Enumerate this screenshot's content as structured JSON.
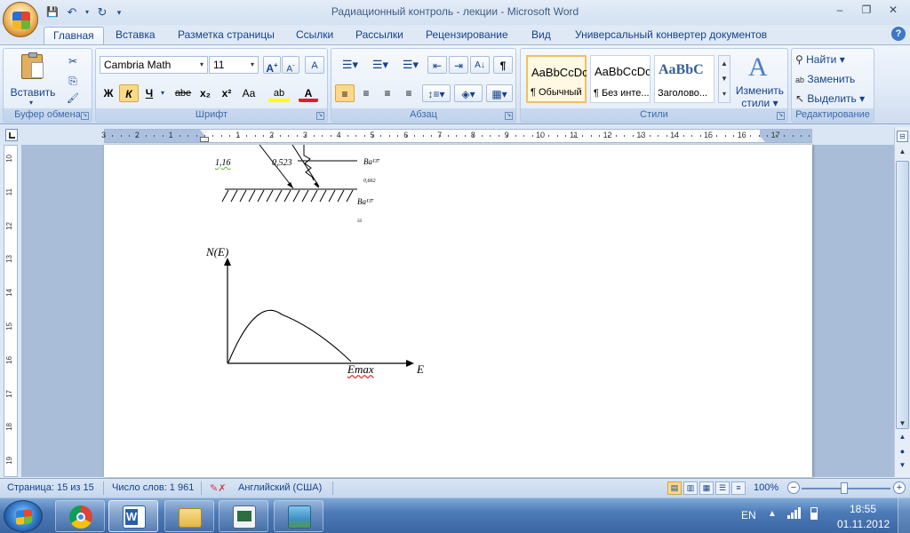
{
  "window": {
    "title": "Радиационный контроль - лекции - Microsoft Word",
    "controls": {
      "minimize": "–",
      "restore": "❐",
      "close": "✕"
    }
  },
  "quick_access": {
    "save": "💾",
    "undo": "↶",
    "redo": "↻",
    "customize": "▾"
  },
  "tabs": [
    "Главная",
    "Вставка",
    "Разметка страницы",
    "Ссылки",
    "Рассылки",
    "Рецензирование",
    "Вид",
    "Универсальный конвертер документов"
  ],
  "help": "?",
  "ribbon": {
    "clipboard": {
      "label": "Буфер обмена",
      "paste": "Вставить",
      "cut": "✂",
      "copy": "⎘",
      "painter": "🖌"
    },
    "font": {
      "label": "Шрифт",
      "family": "Cambria Math",
      "size": "11",
      "grow": "A",
      "grow_sup": "+",
      "shrink": "A",
      "shrink_sup": "-",
      "clear": "A",
      "bold": "Ж",
      "italic": "К",
      "underline": "Ч",
      "strike": "abe",
      "sub": "x₂",
      "sup": "x²",
      "case": "Aa",
      "highlight": "ab",
      "color": "A"
    },
    "paragraph": {
      "label": "Абзац",
      "pilcrow": "¶",
      "sort": "A↓"
    },
    "styles": {
      "label": "Стили",
      "items": [
        {
          "preview": "AaBbCcDc",
          "name": "¶ Обычный"
        },
        {
          "preview": "AaBbCcDc",
          "name": "¶ Без инте..."
        },
        {
          "preview": "AaBbC",
          "name": "Заголово..."
        }
      ],
      "change_label_1": "Изменить",
      "change_label_2": "стили ▾",
      "change_icon": "A"
    },
    "editing": {
      "label": "Редактирование",
      "find": "Найти ▾",
      "replace": "Заменить",
      "select": "Выделить ▾"
    }
  },
  "ruler": {
    "horizontal_ticks": [
      "3",
      "2",
      "1",
      "1",
      "2",
      "3",
      "4",
      "5",
      "6",
      "7",
      "8",
      "9",
      "10",
      "11",
      "12",
      "13",
      "14",
      "15",
      "16",
      "17"
    ],
    "vertical_ticks": [
      "10",
      "11",
      "12",
      "13",
      "14",
      "15",
      "16",
      "17",
      "18",
      "19"
    ]
  },
  "document": {
    "top_figure": {
      "energy_1": "1,16",
      "energy_2": "0,523",
      "level_upper": "Ba¹³⁷",
      "level_middle": "0,662",
      "level_ground": "Ba¹³⁷",
      "mass_number": "56"
    },
    "spectrum_graph": {
      "y_label": "N(E)",
      "x_label": "E",
      "emax_label": "Emax"
    }
  },
  "status_bar": {
    "page": "Страница: 15 из 15",
    "words": "Число слов: 1 961",
    "language": "Английский (США)",
    "zoom": "100%",
    "zoom_minus": "−",
    "zoom_plus": "+"
  },
  "taskbar": {
    "language": "EN",
    "time": "18:55",
    "date": "01.11.2012"
  }
}
